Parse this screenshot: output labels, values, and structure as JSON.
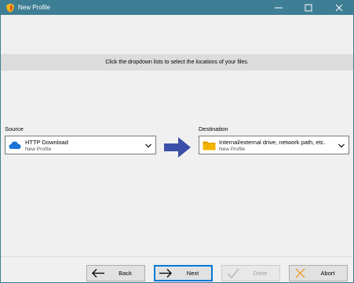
{
  "window": {
    "title": "New Profile",
    "app_icon": "shield-icon",
    "controls": [
      "minimize-icon",
      "maximize-icon",
      "close-icon"
    ]
  },
  "instruction": "Click the dropdown lists to select the locations of your files.",
  "source": {
    "label": "Source",
    "selected": "HTTP Download",
    "sub": "New Profile",
    "icon": "cloud-icon"
  },
  "destination": {
    "label": "Destination",
    "selected": "Internal/external drive, network path, etc.",
    "sub": "New Profile",
    "icon": "folder-icon"
  },
  "buttons": {
    "back": "Back",
    "next": "Next",
    "done": "Done",
    "abort": "Abort"
  },
  "colors": {
    "titlebar": "#3e7e94",
    "arrow": "#3a4fa8",
    "cloud": "#1e73d8",
    "folder": "#f5b400",
    "abort_x": "#f0a030"
  }
}
